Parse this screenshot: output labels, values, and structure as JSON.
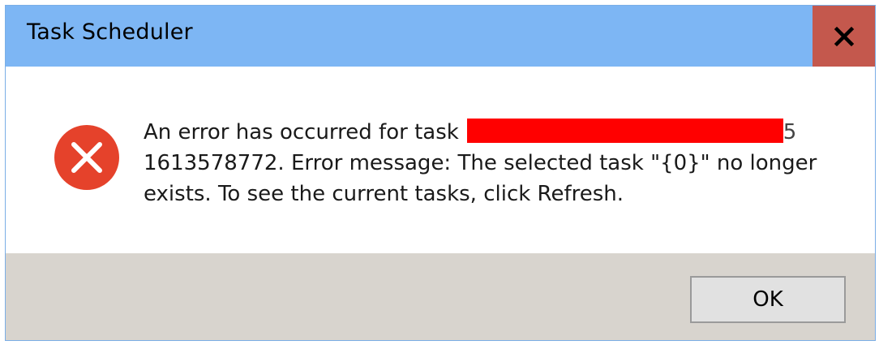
{
  "window": {
    "title": "Task Scheduler",
    "close_icon": "close-icon"
  },
  "message": {
    "icon": "error-icon",
    "line1_prefix": "An error has occurred for task",
    "redacted_tail": "5",
    "line2": "1613578772. Error message: The selected task \"{0}\" no longer",
    "line3": "exists. To see the current tasks, click Refresh."
  },
  "footer": {
    "ok_label": "OK"
  },
  "colors": {
    "titlebar": "#7db6f4",
    "close_button": "#c4584d",
    "error_icon": "#e5422b",
    "redaction": "#ff0000",
    "footer": "#d8d4ce"
  }
}
